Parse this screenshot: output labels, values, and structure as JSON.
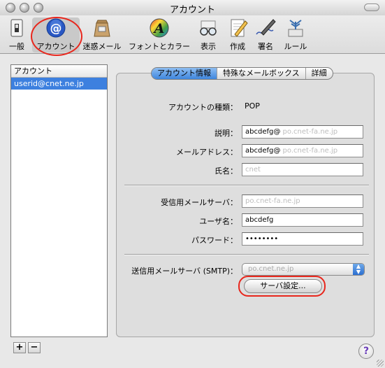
{
  "window": {
    "title": "アカウント"
  },
  "toolbar": {
    "items": [
      {
        "label": "一般",
        "icon": "switch-icon"
      },
      {
        "label": "アカウント",
        "icon": "at-sign-icon",
        "selected": true
      },
      {
        "label": "迷惑メール",
        "icon": "junk-mail-bag-icon"
      },
      {
        "label": "フォントとカラー",
        "icon": "font-color-icon"
      },
      {
        "label": "表示",
        "icon": "eyeglasses-icon"
      },
      {
        "label": "作成",
        "icon": "compose-pencil-icon"
      },
      {
        "label": "署名",
        "icon": "signature-pen-icon"
      },
      {
        "label": "ルール",
        "icon": "rules-icon"
      }
    ]
  },
  "accounts": {
    "header": "アカウント",
    "items": [
      "userid@cnet.ne.jp"
    ]
  },
  "tabs": [
    "アカウント情報",
    "特殊なメールボックス",
    "詳細"
  ],
  "account_info": {
    "type_label": "アカウントの種類：",
    "type_value": "POP",
    "description_label": "説明：",
    "description_value": "abcdefg@",
    "description_blur": "po.cnet-fa.ne.jp",
    "email_label": "メールアドレス：",
    "email_value": "abcdefg@",
    "email_blur": "po.cnet-fa.ne.jp",
    "name_label": "氏名：",
    "name_value": "cnet",
    "incoming_label": "受信用メールサーバ：",
    "incoming_value": "po.cnet-fa.ne.jp",
    "username_label": "ユーザ名：",
    "username_value": "abcdefg",
    "password_label": "パスワード：",
    "password_value": "••••••••",
    "smtp_label": "送信用メールサーバ (SMTP)：",
    "smtp_value": "po.cnet.ne.jp",
    "server_settings_button": "サーバ設定..."
  },
  "buttons": {
    "add": "+",
    "remove": "−",
    "help": "?"
  },
  "colors": {
    "selection": "#3d80df",
    "highlight_circle": "#e8261c",
    "tab_active": "#3f86de"
  }
}
